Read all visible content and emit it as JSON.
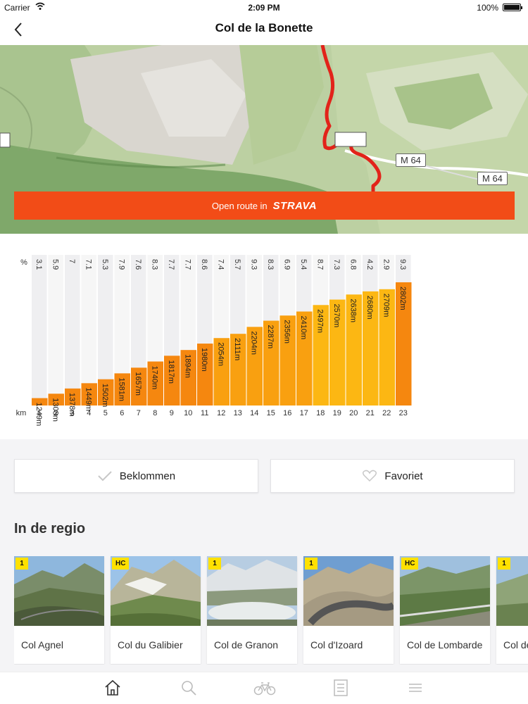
{
  "status": {
    "carrier": "Carrier",
    "time": "2:09 PM",
    "battery": "100%"
  },
  "nav": {
    "title": "Col de la Bonette"
  },
  "map": {
    "road_labels": [
      "M 64",
      "M 64"
    ],
    "strava_prefix": "Open route in",
    "strava_brand": "STRAVA"
  },
  "profile": {
    "percent_label": "%",
    "km_label": "km",
    "grades": [
      "3.1",
      "5.9",
      "7",
      "7.1",
      "5.3",
      "7.9",
      "7.6",
      "8.3",
      "7.7",
      "7.7",
      "8.6",
      "7.4",
      "5.7",
      "9.3",
      "8.3",
      "6.9",
      "5.4",
      "8.7",
      "7.3",
      "6.8",
      "4.2",
      "2.9",
      "9.3"
    ],
    "km": [
      "1",
      "2",
      "3",
      "4",
      "5",
      "6",
      "7",
      "8",
      "9",
      "10",
      "11",
      "12",
      "13",
      "14",
      "15",
      "16",
      "17",
      "18",
      "19",
      "20",
      "21",
      "22",
      "23"
    ],
    "elevations": [
      "1249m",
      "1308m",
      "1378m",
      "1449m",
      "1502m",
      "1581m",
      "1657m",
      "1740m",
      "1817m",
      "1894m",
      "1980m",
      "2054m",
      "2111m",
      "2204m",
      "2287m",
      "2356m",
      "2410m",
      "2497m",
      "2570m",
      "2638m",
      "2680m",
      "2709m",
      "2802m"
    ],
    "elevation_values": [
      1249,
      1308,
      1378,
      1449,
      1502,
      1581,
      1657,
      1740,
      1817,
      1894,
      1980,
      2054,
      2111,
      2204,
      2287,
      2356,
      2410,
      2497,
      2570,
      2638,
      2680,
      2709,
      2802
    ]
  },
  "actions": {
    "climbed": "Beklommen",
    "favorite": "Favoriet"
  },
  "region": {
    "title": "In de regio",
    "cards": [
      {
        "badge": "1",
        "name": "Col Agnel"
      },
      {
        "badge": "HC",
        "name": "Col du Galibier"
      },
      {
        "badge": "1",
        "name": "Col de Granon"
      },
      {
        "badge": "1",
        "name": "Col d'Izoard"
      },
      {
        "badge": "HC",
        "name": "Col de Lombarde"
      },
      {
        "badge": "1",
        "name": "Col de la Cayolle"
      }
    ]
  },
  "tabs": [
    "home-icon",
    "search-icon",
    "bike-icon",
    "list-card-icon",
    "menu-icon"
  ],
  "colors": {
    "accent": "#f24c17",
    "badge": "#ffe100",
    "bar_dark": "#f27a0c",
    "bar_light": "#fdb813"
  }
}
